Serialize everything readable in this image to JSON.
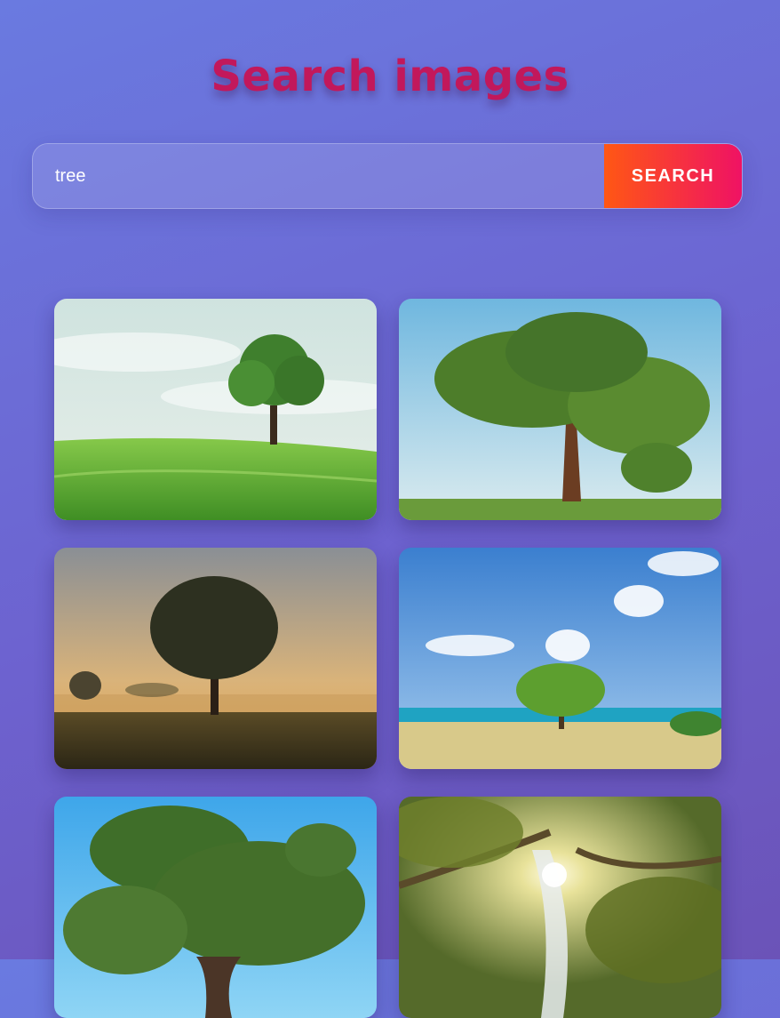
{
  "header": {
    "title": "Search images"
  },
  "search": {
    "value": "tree",
    "button_label": "SEARCH"
  },
  "results": {
    "images": [
      {
        "name": "tree-on-grass-hill"
      },
      {
        "name": "large-tree-on-field"
      },
      {
        "name": "tree-in-misty-sunrise"
      },
      {
        "name": "tree-on-beach"
      },
      {
        "name": "tree-under-blue-sky"
      },
      {
        "name": "tree-canopy-with-sun"
      }
    ]
  },
  "colors": {
    "title": "#c2185b",
    "button_start": "#ff5714",
    "button_end": "#ef1264",
    "background_start": "#6a7ae0",
    "background_end": "#6b53b8"
  }
}
